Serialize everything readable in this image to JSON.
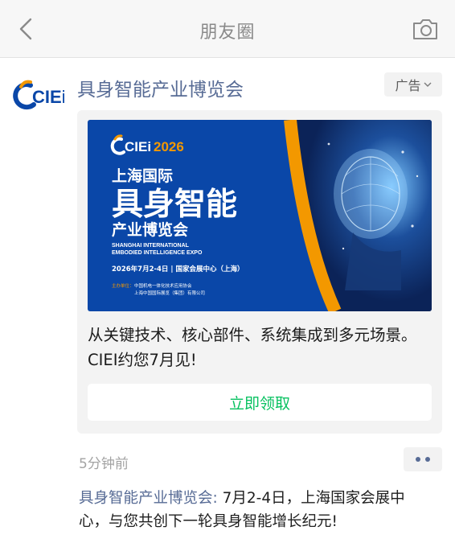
{
  "nav": {
    "title": "朋友圈",
    "back_icon": "chevron-left-icon",
    "camera_icon": "camera-icon"
  },
  "advertiser": {
    "logo_text": "CIEi",
    "name": "具身智能产业博览会",
    "ad_label": "广告"
  },
  "banner": {
    "logo_text": "CIEi",
    "year": "2026",
    "title_line1": "上海国际",
    "title_line2": "具身智能",
    "title_line3": "产业博览会",
    "en_line1": "SHANGHAI INTERNATIONAL",
    "en_line2": "EMBODIED INTELLIGENCE EXPO",
    "date_venue": "2026年7月2-4日 | 国家会展中心（上海）",
    "organizer_label": "主办单位：",
    "organizer_1": "中国机电一体化技术应用协会",
    "organizer_2": "上海中国国际展览（集团）有限公司"
  },
  "ad": {
    "text": "从关键技术、核心部件、系统集成到多元场景。CIEI约您7月见!",
    "cta_label": "立即领取"
  },
  "footer": {
    "time": "5分钟前",
    "comment_author": "具身智能产业博览会:",
    "comment_text": " 7月2-4日，上海国家会展中心，与您共创下一轮具身智能增长纪元!"
  },
  "colors": {
    "link_blue": "#576b95",
    "cta_green": "#07c160",
    "banner_blue": "#0a47a8",
    "banner_orange": "#f39800"
  }
}
